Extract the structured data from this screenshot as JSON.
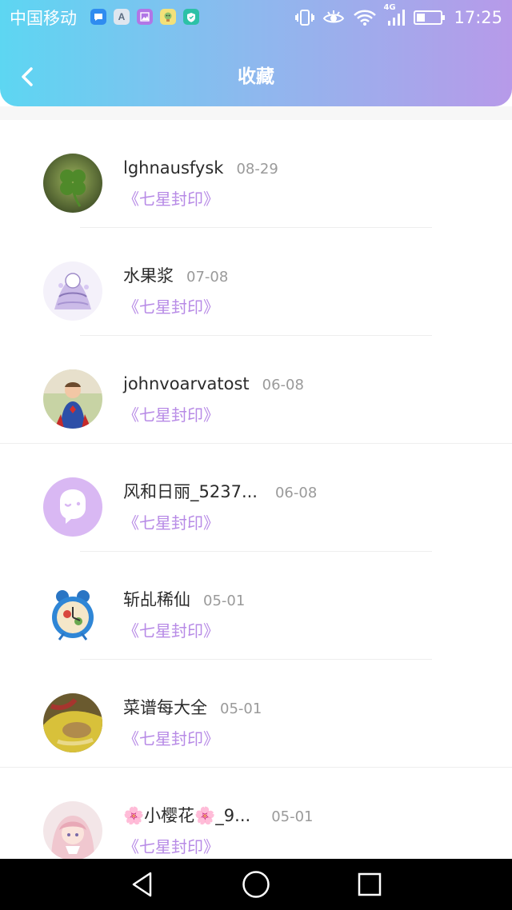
{
  "status_bar": {
    "carrier": "中国移动",
    "time": "17:25",
    "network": "4G",
    "notification_icons": [
      "message-icon",
      "a-icon",
      "image-icon",
      "face-icon",
      "shield-icon"
    ],
    "system_icons": [
      "vibrate-icon",
      "eye-icon",
      "wifi-icon",
      "signal-icon",
      "battery-icon"
    ]
  },
  "nav": {
    "title": "收藏",
    "back_icon": "chevron-left-icon"
  },
  "colors": {
    "header_gradient": [
      "#5dd6f2",
      "#8eb8ee",
      "#b79ae9"
    ],
    "book_title": "#b78ae6",
    "date": "#9a9a9a",
    "name": "#2b2b2b"
  },
  "favorites": [
    {
      "name": "lghnausfysk",
      "date": "08-29",
      "book": "《七星封印》",
      "avatar": "clover"
    },
    {
      "name": "水果浆",
      "date": "07-08",
      "book": "《七星封印》",
      "avatar": "anime-sketch"
    },
    {
      "name": "johnvoarvatost",
      "date": "06-08",
      "book": "《七星封印》",
      "avatar": "child-superman"
    },
    {
      "name": "风和日丽_5237...",
      "date": "06-08",
      "book": "《七星封印》",
      "avatar": "default-chat"
    },
    {
      "name": "斩乩稀仙",
      "date": "05-01",
      "book": "《七星封印》",
      "avatar": "alarm-clock"
    },
    {
      "name": "菜谱每大全",
      "date": "05-01",
      "book": "《七星封印》",
      "avatar": "food-photo"
    },
    {
      "name": "🌸小樱花🌸_9...",
      "date": "05-01",
      "book": "《七星封印》",
      "avatar": "anime-girl"
    }
  ],
  "system_nav": [
    "back-triangle-icon",
    "home-circle-icon",
    "recents-square-icon"
  ]
}
